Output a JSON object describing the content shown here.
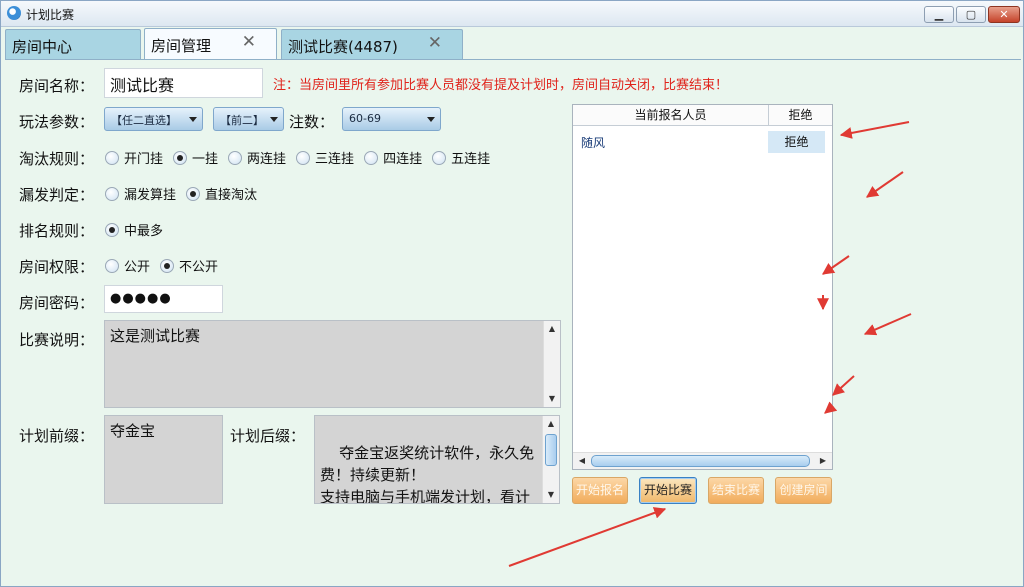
{
  "window": {
    "title": "计划比赛",
    "minimize_symbol": "▁",
    "maximize_symbol": "▢",
    "close_symbol": "✕"
  },
  "tabs": [
    {
      "label": "房间中心",
      "closable": false
    },
    {
      "label": "房间管理",
      "closable": true
    },
    {
      "label": "测试比赛(4487)",
      "closable": true
    }
  ],
  "tab_close_symbol": "✕",
  "form": {
    "room_name": {
      "label": "房间名称：",
      "value": "测试比赛"
    },
    "note": "注：当房间里所有参加比赛人员都没有提及计划时，房间自动关闭，比赛结束！",
    "play_params": {
      "label": "玩法参数：",
      "combo1": "【任二直选】",
      "combo2": "【前二】",
      "count_label": "注数：",
      "combo3": "60-69"
    },
    "elimination": {
      "label": "淘汰规则：",
      "options": [
        "开门挂",
        "一挂",
        "两连挂",
        "三连挂",
        "四连挂",
        "五连挂"
      ],
      "selected": 1
    },
    "miss_judge": {
      "label": "漏发判定：",
      "options": [
        "漏发算挂",
        "直接淘汰"
      ],
      "selected": 1
    },
    "ranking": {
      "label": "排名规则：",
      "options": [
        "中最多"
      ],
      "selected": 0
    },
    "permission": {
      "label": "房间权限：",
      "options": [
        "公开",
        "不公开"
      ],
      "selected": 1
    },
    "password": {
      "label": "房间密码：",
      "value": "●●●●●"
    },
    "description": {
      "label": "比赛说明：",
      "value": "这是测试比赛"
    },
    "prefix": {
      "label": "计划前缀：",
      "value": "夺金宝"
    },
    "suffix": {
      "label": "计划后缀：",
      "value": "夺金宝返奖统计软件，永久免费！持续更新！\n支持电脑与手机端发计划，看计划，缩水做号！"
    }
  },
  "grid": {
    "headers": [
      "当前报名人员",
      "拒绝"
    ],
    "rows": [
      {
        "name": "随风",
        "action": "拒绝"
      }
    ]
  },
  "scroll_symbols": {
    "up": "▲",
    "down": "▼",
    "left": "◀",
    "right": "▶"
  },
  "actions": [
    {
      "label": "开始报名",
      "active": false
    },
    {
      "label": "开始比赛",
      "active": true
    },
    {
      "label": "结束比赛",
      "active": false
    },
    {
      "label": "创建房间",
      "active": false
    }
  ],
  "colors": {
    "background": "#eaf6ee",
    "tab_inactive": "#a9d5e3",
    "note_red": "#e0231b",
    "annotation_arrow": "#e03a33",
    "button_orange": "#f1ac5c"
  }
}
